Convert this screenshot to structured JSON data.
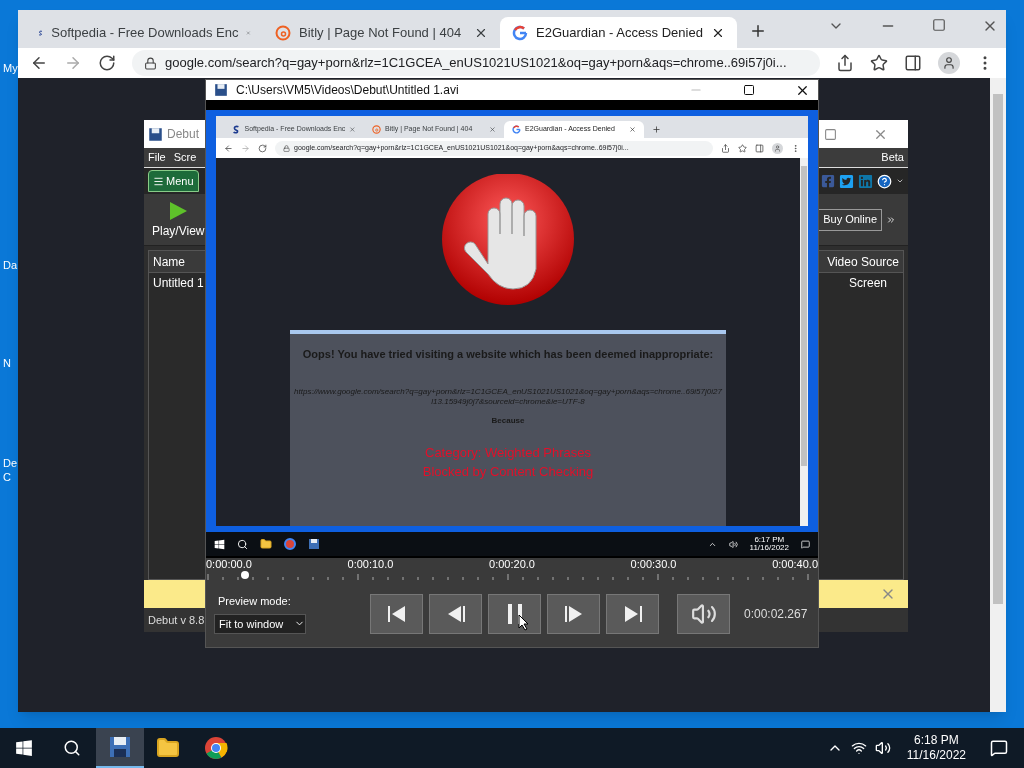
{
  "desktop": {
    "icon_labels": [
      "My",
      "Da",
      "N",
      "De",
      "C"
    ]
  },
  "browser": {
    "tabs": [
      {
        "title": "Softpedia - Free Downloads Enc",
        "kind": "softpedia",
        "selected": false
      },
      {
        "title": "Bitly | Page Not Found | 404",
        "kind": "bitly",
        "selected": false
      },
      {
        "title": "E2Guardian - Access Denied",
        "kind": "google",
        "selected": true
      }
    ],
    "address": "google.com/search?q=gay+porn&rlz=1C1GCEA_enUS1021US1021&oq=gay+porn&aqs=chrome..69i57j0i..."
  },
  "debut": {
    "title": "Debut",
    "menu": [
      "File",
      "Scre"
    ],
    "menu_button": "Menu",
    "play_button": "Play/View",
    "badge": "Beta",
    "buy_button": "Buy Online",
    "columns": [
      "Name",
      "Video Source"
    ],
    "rows": [
      [
        "Untitled 1",
        "Screen"
      ]
    ],
    "status": "Debut v 8.8"
  },
  "player": {
    "title": "C:\\Users\\VM5\\Videos\\Debut\\Untitled 1.avi",
    "video": {
      "tabs": [
        {
          "title": "Softpedia - Free Downloads Enc",
          "kind": "softpedia",
          "selected": false
        },
        {
          "title": "Bitly | Page Not Found | 404",
          "kind": "bitly",
          "selected": false
        },
        {
          "title": "E2Guardian - Access Denied",
          "kind": "google",
          "selected": true
        }
      ],
      "address": "google.com/search?q=gay+porn&rlz=1C1GCEA_enUS1021US1021&oq=gay+porn&aqs=chrome..69i57j0i...",
      "message": "Oops! You have tried visiting a website which has been deemed inappropriate:",
      "url": "https://www.google.com/search?q=gay+porn&rlz=1C1GCEA_enUS1021US1021&oq=gay+porn&aqs=chrome..69i57j0i27l13.15949j0j7&sourceid=chrome&ie=UTF-8",
      "because": "Because",
      "reasons": [
        "Category: Weighted Phrases",
        "Blocked by Content Checking"
      ],
      "clock_time": "6:17 PM",
      "clock_date": "11/16/2022"
    },
    "timeline": {
      "level": 0.057,
      "labels": [
        "0:00:00.0",
        "0:00:10.0",
        "0:00:20.0",
        "0:00:30.0",
        "0:00:40.0"
      ]
    },
    "preview_label": "Preview mode:",
    "preview_value": "Fit to window",
    "controls": [
      {
        "kind": "first"
      },
      {
        "kind": "step-back"
      },
      {
        "kind": "pause"
      },
      {
        "kind": "step-forward"
      },
      {
        "kind": "last"
      }
    ],
    "time": "0:00:02.267"
  },
  "taskbar": {
    "apps": [
      {
        "kind": "debut",
        "selected": true
      },
      {
        "kind": "folder",
        "selected": false
      },
      {
        "kind": "chrome",
        "selected": false
      }
    ],
    "time": "6:18 PM",
    "date": "11/16/2022"
  }
}
